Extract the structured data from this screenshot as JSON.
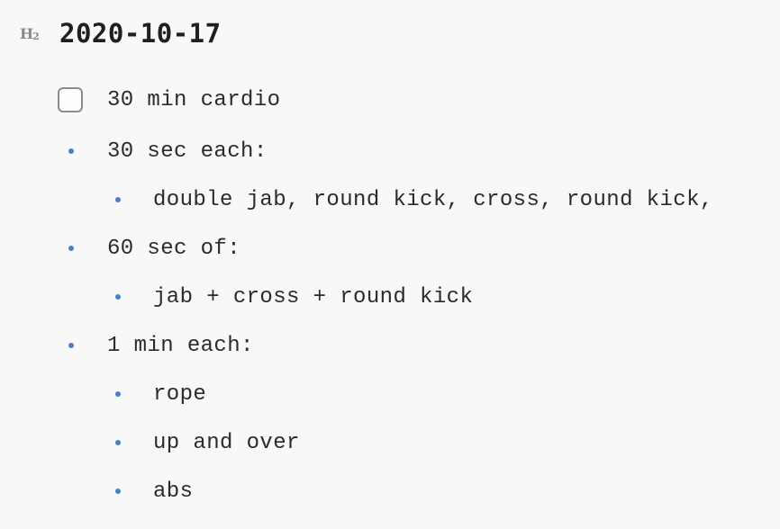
{
  "heading": {
    "level_marker": "H",
    "level_number": "2",
    "title": "2020-10-17"
  },
  "items": [
    {
      "type": "checkbox",
      "checked": false,
      "text": "30 min cardio"
    },
    {
      "type": "bullet",
      "level": 1,
      "text": "30 sec each:"
    },
    {
      "type": "bullet",
      "level": 2,
      "text": "double jab, round kick, cross, round kick,"
    },
    {
      "type": "bullet",
      "level": 1,
      "text": "60 sec of:"
    },
    {
      "type": "bullet",
      "level": 2,
      "text": "jab + cross + round kick"
    },
    {
      "type": "bullet",
      "level": 1,
      "text": "1 min each:"
    },
    {
      "type": "bullet",
      "level": 2,
      "text": "rope"
    },
    {
      "type": "bullet",
      "level": 2,
      "text": "up and over"
    },
    {
      "type": "bullet",
      "level": 2,
      "text": "abs"
    }
  ],
  "colors": {
    "background": "#f8f8f8",
    "text": "#2b2b2b",
    "bullet": "#4d7fc4",
    "heading_marker": "#8a8a8a",
    "checkbox_border": "#8c8c8c"
  }
}
